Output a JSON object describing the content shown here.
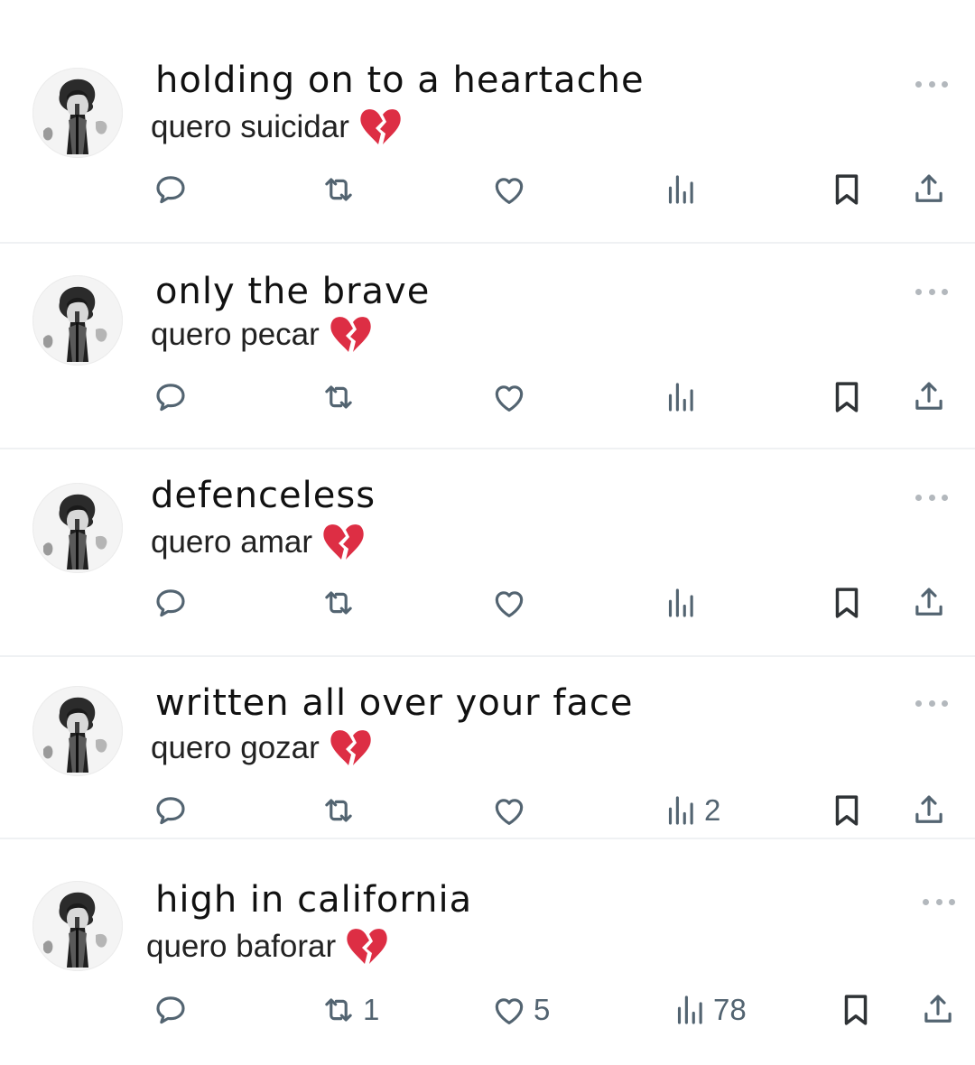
{
  "posts": [
    {
      "title": "holding on to a heartache",
      "subtitle": "quero suicidar",
      "counts": {
        "reply": "",
        "repost": "",
        "like": "",
        "views": ""
      }
    },
    {
      "title": "only the brave",
      "subtitle": "quero pecar",
      "counts": {
        "reply": "",
        "repost": "",
        "like": "",
        "views": ""
      }
    },
    {
      "title": "defenceless",
      "subtitle": "quero amar",
      "counts": {
        "reply": "",
        "repost": "",
        "like": "",
        "views": ""
      }
    },
    {
      "title": "written all over your face",
      "subtitle": "quero gozar",
      "counts": {
        "reply": "",
        "repost": "",
        "like": "",
        "views": "2"
      }
    },
    {
      "title": "high in california",
      "subtitle": "quero baforar",
      "counts": {
        "reply": "",
        "repost": "1",
        "like": "5",
        "views": "78"
      }
    }
  ],
  "icons": {
    "reply": "speech-bubble-icon",
    "repost": "repost-arrows-icon",
    "like": "heart-outline-icon",
    "views": "views-bar-chart-icon",
    "bookmark": "bookmark-icon",
    "share": "share-upload-icon",
    "more": "more-dots-icon",
    "emoji": "broken-heart-emoji"
  },
  "colors": {
    "icon": "#536471",
    "brokenHeart": "#dd2e44",
    "divider": "#eff1f3"
  }
}
